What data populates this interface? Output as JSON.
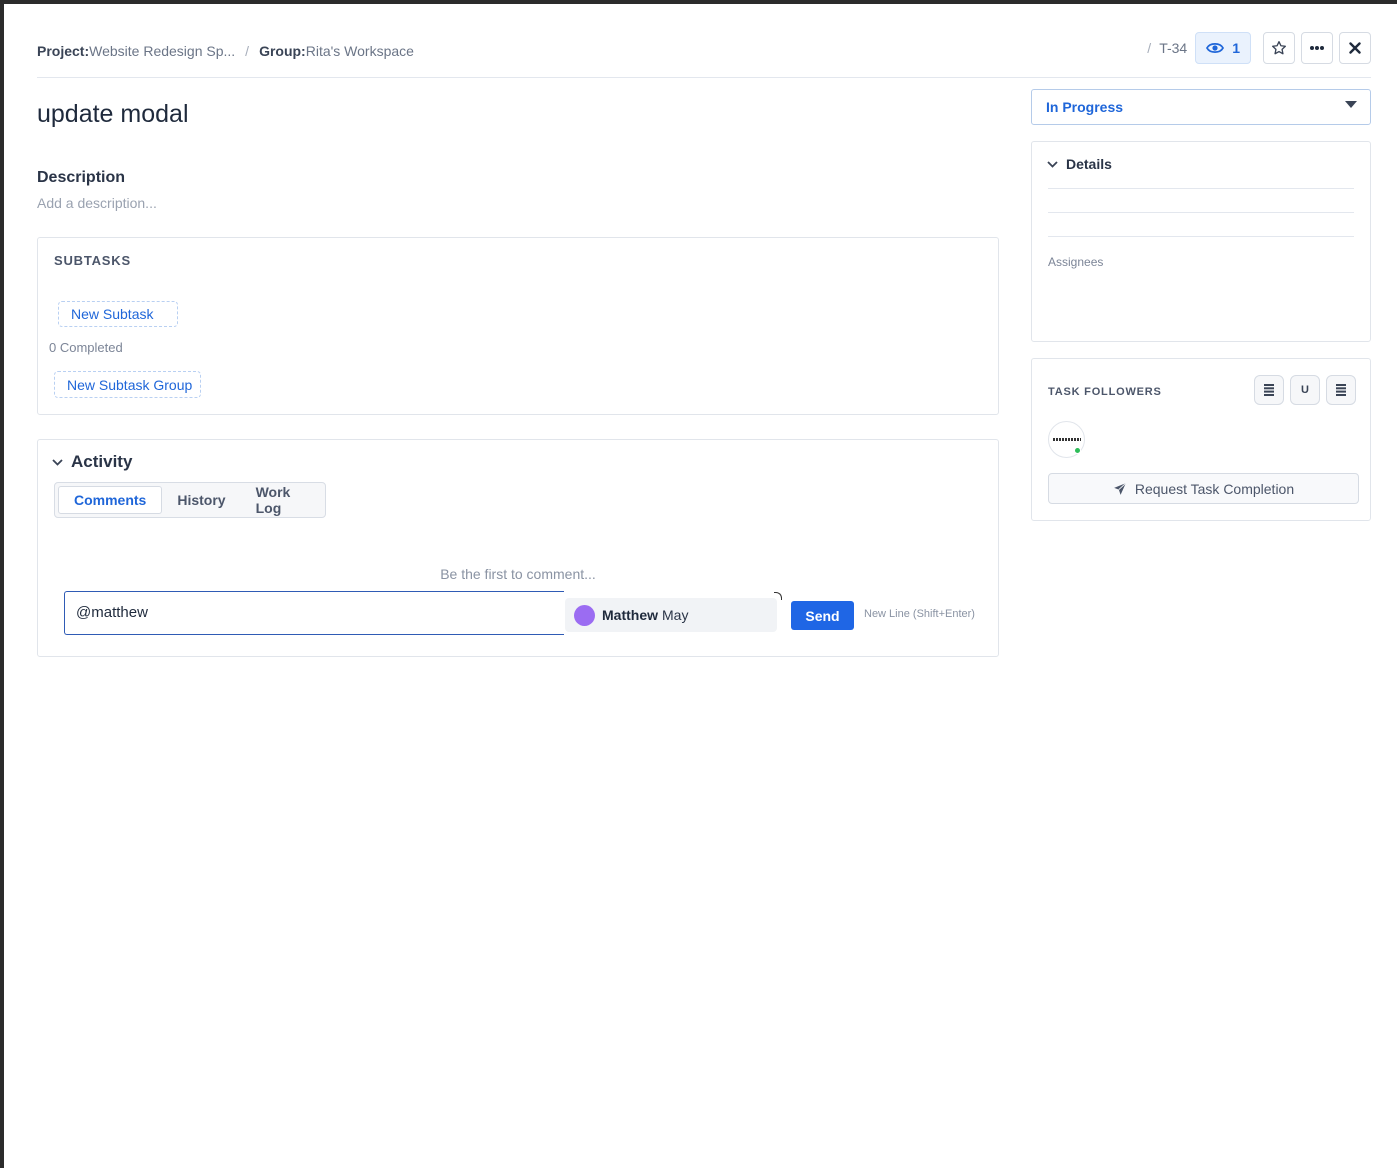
{
  "header": {
    "project_label": "Project:",
    "project_value": "Website Redesign Sp...",
    "group_label": "Group:",
    "group_value": "Rita's Workspace",
    "breadcrumb_separator": "/",
    "task_id": "T-34",
    "watchers_count": "1",
    "icons": {
      "watch": "eye-icon",
      "favorite": "star-icon",
      "more": "more-horizontal-icon",
      "close": "close-icon"
    }
  },
  "task": {
    "title": "update modal",
    "description_heading": "Description",
    "description_placeholder": "Add a description..."
  },
  "subtasks": {
    "heading": "SUBTASKS",
    "new_subtask_label": "New Subtask",
    "completed_text": "0 Completed",
    "new_group_label": "New Subtask Group"
  },
  "activity": {
    "heading": "Activity",
    "tabs": [
      {
        "label": "Comments",
        "active": true
      },
      {
        "label": "History",
        "active": false
      },
      {
        "label": "Work Log",
        "active": false
      }
    ],
    "empty_text": "Be the first to comment...",
    "comment_value": "@matthew",
    "mention_suggestion": {
      "first": "Matthew",
      "last": "May",
      "avatar_color": "#9b6cf2"
    },
    "send_label": "Send",
    "newline_hint": "New Line (Shift+Enter)"
  },
  "sidebar": {
    "status": "In Progress",
    "details_heading": "Details",
    "assignees_label": "Assignees",
    "followers_heading": "TASK FOLLOWERS",
    "follower_buttons": [
      "list-icon",
      "U",
      "list-icon"
    ],
    "request_completion_label": "Request Task Completion"
  },
  "colors": {
    "accent": "#1f66d9",
    "send": "#1f66e5",
    "online": "#2ebd59"
  }
}
